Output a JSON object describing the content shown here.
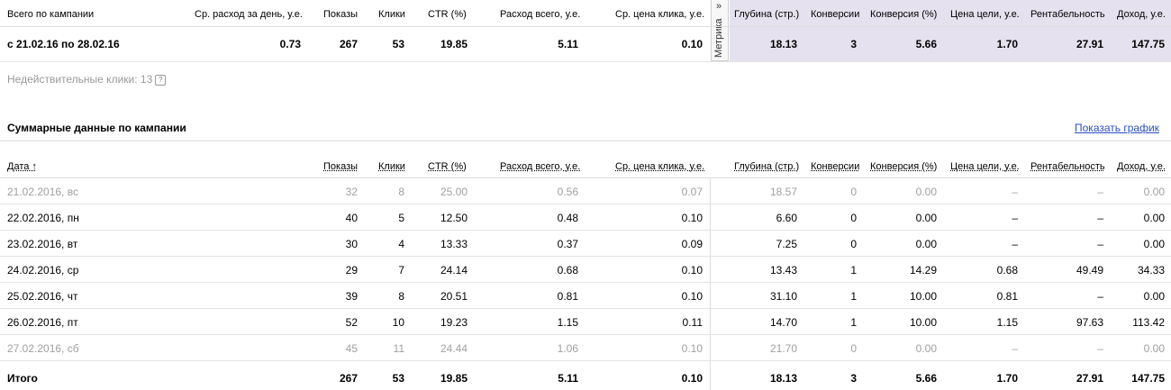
{
  "summary": {
    "headers": [
      "Всего по кампании",
      "Ср. расход за день, у.е.",
      "Показы",
      "Клики",
      "CTR (%)",
      "Расход всего, у.е.",
      "Ср. цена клика, у.е.",
      "Глубина (стр.)",
      "Конверсии",
      "Конверсия (%)",
      "Цена цели, у.е.",
      "Рентабельность",
      "Доход, у.е."
    ],
    "row": [
      "с 21.02.16 по 28.02.16",
      "0.73",
      "267",
      "53",
      "19.85",
      "5.11",
      "0.10",
      "18.13",
      "3",
      "5.66",
      "1.70",
      "27.91",
      "147.75"
    ],
    "metrika_label": "Метрика",
    "metrika_arrow": "»"
  },
  "invalid_clicks": {
    "label": "Недействительные клики: 13",
    "help": "?"
  },
  "section": {
    "title": "Суммарные данные по кампании",
    "show_chart": "Показать график"
  },
  "table": {
    "headers": [
      "Дата ↑",
      "Показы",
      "Клики",
      "CTR (%)",
      "Расход всего, у.е.",
      "Ср. цена клика, у.е.",
      "Глубина (стр.)",
      "Конверсии",
      "Конверсия (%)",
      "Цена цели, у.е.",
      "Рентабельность",
      "Доход, у.е."
    ],
    "rows": [
      {
        "cells": [
          "21.02.2016, вс",
          "32",
          "8",
          "25.00",
          "0.56",
          "0.07",
          "18.57",
          "0",
          "0.00",
          "–",
          "–",
          "0.00"
        ],
        "muted": true
      },
      {
        "cells": [
          "22.02.2016, пн",
          "40",
          "5",
          "12.50",
          "0.48",
          "0.10",
          "6.60",
          "0",
          "0.00",
          "–",
          "–",
          "0.00"
        ],
        "muted": false
      },
      {
        "cells": [
          "23.02.2016, вт",
          "30",
          "4",
          "13.33",
          "0.37",
          "0.09",
          "7.25",
          "0",
          "0.00",
          "–",
          "–",
          "0.00"
        ],
        "muted": false
      },
      {
        "cells": [
          "24.02.2016, ср",
          "29",
          "7",
          "24.14",
          "0.68",
          "0.10",
          "13.43",
          "1",
          "14.29",
          "0.68",
          "49.49",
          "34.33"
        ],
        "muted": false
      },
      {
        "cells": [
          "25.02.2016, чт",
          "39",
          "8",
          "20.51",
          "0.81",
          "0.10",
          "31.10",
          "1",
          "10.00",
          "0.81",
          "–",
          "0.00"
        ],
        "muted": false
      },
      {
        "cells": [
          "26.02.2016, пт",
          "52",
          "10",
          "19.23",
          "1.15",
          "0.11",
          "14.70",
          "1",
          "10.00",
          "1.15",
          "97.63",
          "113.42"
        ],
        "muted": false
      },
      {
        "cells": [
          "27.02.2016, сб",
          "45",
          "11",
          "24.44",
          "1.06",
          "0.10",
          "21.70",
          "0",
          "0.00",
          "–",
          "–",
          "0.00"
        ],
        "muted": true
      }
    ],
    "total": [
      "Итого",
      "267",
      "53",
      "19.85",
      "5.11",
      "0.10",
      "18.13",
      "3",
      "5.66",
      "1.70",
      "27.91",
      "147.75"
    ]
  }
}
